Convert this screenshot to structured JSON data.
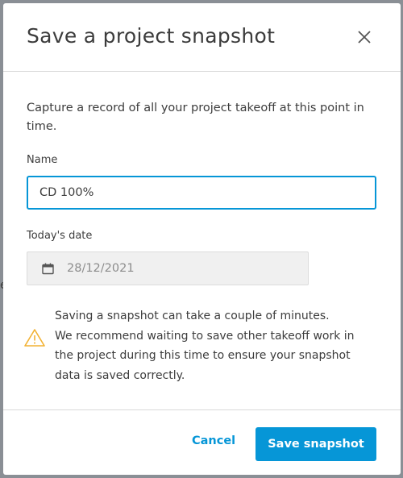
{
  "dialog": {
    "title": "Save a project snapshot",
    "description": "Capture a record of all your project takeoff at this point in time.",
    "name_label": "Name",
    "name_value": "CD 100%",
    "date_label": "Today's date",
    "date_value": "28/12/2021",
    "warning_lines": [
      "Saving a snapshot can take a couple of minutes.",
      "We recommend waiting to save other takeoff work in",
      "the project during this time to ensure your snapshot",
      "data is saved correctly."
    ],
    "cancel_label": "Cancel",
    "save_label": "Save snapshot"
  },
  "icons": {
    "close": "close-icon",
    "calendar": "calendar-icon",
    "warning": "warning-icon"
  },
  "colors": {
    "accent": "#0696d7",
    "warning": "#f2b233",
    "backdrop": "#8a8f95"
  }
}
